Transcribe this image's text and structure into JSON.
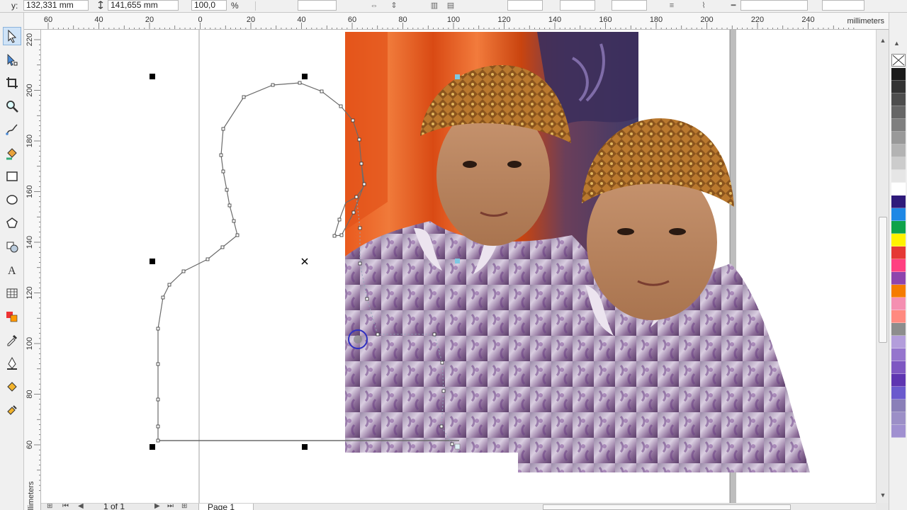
{
  "property_bar": {
    "y_label": "y:",
    "y_value": "132,331 mm",
    "height_value": "141,655 mm",
    "scale_value": "100,0",
    "scale_unit": "%"
  },
  "ruler": {
    "units": "millimeters",
    "h_ticks": [
      "60",
      "40",
      "20",
      "0",
      "20",
      "40",
      "60",
      "80",
      "100",
      "120",
      "140",
      "160",
      "180",
      "200",
      "220",
      "240"
    ],
    "v_ticks": [
      "220",
      "200",
      "180",
      "160",
      "140",
      "120",
      "100",
      "80",
      "60"
    ]
  },
  "page_nav": {
    "count": "1 of 1",
    "tab": "Page 1"
  },
  "tools": [
    {
      "name": "pick-tool-icon"
    },
    {
      "name": "shape-tool-icon"
    },
    {
      "name": "crop-tool-icon"
    },
    {
      "name": "zoom-tool-icon"
    },
    {
      "name": "freehand-tool-icon"
    },
    {
      "name": "smart-fill-tool-icon"
    },
    {
      "name": "rectangle-tool-icon"
    },
    {
      "name": "ellipse-tool-icon"
    },
    {
      "name": "polygon-tool-icon"
    },
    {
      "name": "basic-shapes-tool-icon"
    },
    {
      "name": "text-tool-icon"
    },
    {
      "name": "table-tool-icon"
    },
    {
      "name": "interactive-tool-icon"
    },
    {
      "name": "eyedropper-tool-icon"
    },
    {
      "name": "outline-pen-tool-icon"
    },
    {
      "name": "fill-tool-icon"
    },
    {
      "name": "interactive-fill-tool-icon"
    }
  ],
  "palette": [
    "#1a1a1a",
    "#333333",
    "#4d4d4d",
    "#666666",
    "#7f7f7f",
    "#999999",
    "#b3b3b3",
    "#cccccc",
    "#e6e6e6",
    "#ffffff",
    "#2e1a7a",
    "#1e88e5",
    "#0fa34b",
    "#fff200",
    "#e53935",
    "#ff4081",
    "#8e44ad",
    "#f57c00",
    "#f48fb1",
    "#ff8a80",
    "#8d8d8d",
    "#b39ddb",
    "#9575cd",
    "#7e57c2",
    "#5e35b1",
    "#6a5acd",
    "#8a7fb8",
    "#9c8fc7",
    "#a090d0"
  ],
  "colors": {
    "selection_handle": "#000000",
    "node_fill": "#ffffff",
    "curve_stroke": "#6b6b6b",
    "photo_node_selected": "#7ec8e3",
    "tool_active_bg": "#cfe3f7"
  }
}
